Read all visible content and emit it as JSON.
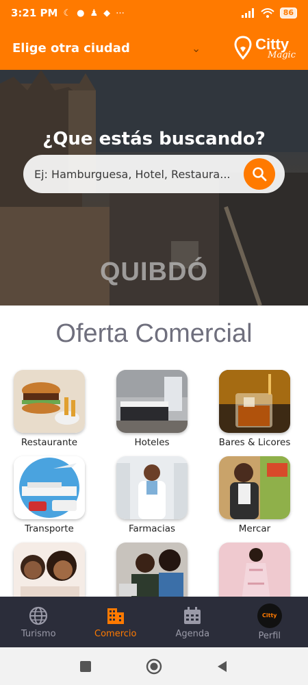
{
  "status_bar": {
    "time": "3:21 PM",
    "battery": "86"
  },
  "header": {
    "city_select_label": "Elige otra ciudad",
    "brand_name": "Citty",
    "brand_sub": "Magic"
  },
  "hero": {
    "title": "¿Que estás buscando?",
    "search_placeholder": "Ej: Hamburguesa, Hotel, Restaura...",
    "city_name": "QUIBDÓ"
  },
  "section": {
    "title": "Oferta Comercial"
  },
  "categories": [
    {
      "label": "Restaurante"
    },
    {
      "label": "Hoteles"
    },
    {
      "label": "Bares & Licores"
    },
    {
      "label": "Transporte"
    },
    {
      "label": "Farmacias"
    },
    {
      "label": "Mercar"
    },
    {
      "label": ""
    },
    {
      "label": ""
    },
    {
      "label": ""
    }
  ],
  "bottom_nav": {
    "items": [
      {
        "label": "Turismo",
        "icon": "globe-icon"
      },
      {
        "label": "Comercio",
        "icon": "building-icon"
      },
      {
        "label": "Agenda",
        "icon": "calendar-icon"
      },
      {
        "label": "Perfil",
        "icon": "avatar"
      }
    ],
    "avatar_text": "Citty"
  },
  "colors": {
    "accent": "#ff7a00",
    "nav_bg": "#2b2d3a"
  }
}
